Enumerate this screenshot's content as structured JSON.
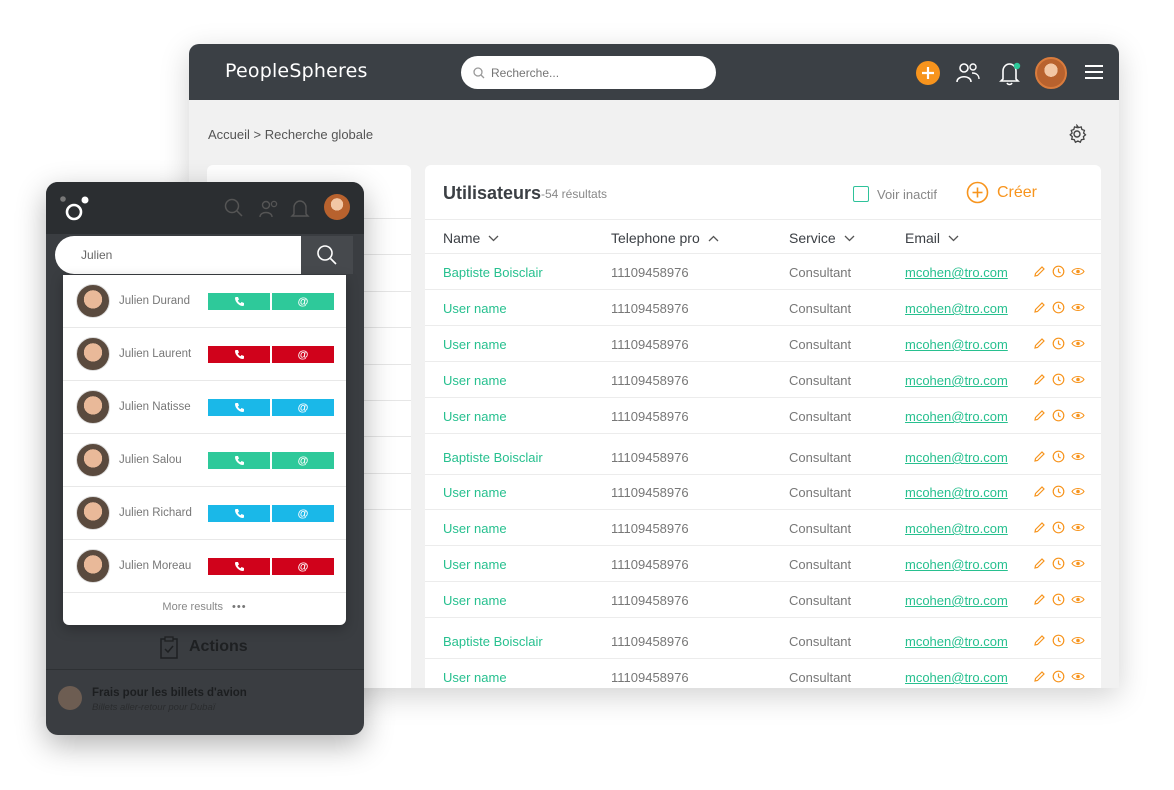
{
  "app": {
    "logo": "PeopleSpheres"
  },
  "header": {
    "search_placeholder": "Recherche..."
  },
  "breadcrumb": "Accueil > Recherche globale",
  "users_card": {
    "title": "Utilisateurs",
    "count": "-54 résultats",
    "voir_inactif": "Voir inactif",
    "create_label": "Créer",
    "columns": [
      "Name",
      "Telephone pro",
      "Service",
      "Email"
    ],
    "rows": [
      {
        "name": "Baptiste Boisclair",
        "tel": "11109458976",
        "service": "Consultant",
        "email": "mcohen@tro.com"
      },
      {
        "name": "User name",
        "tel": "11109458976",
        "service": "Consultant",
        "email": "mcohen@tro.com"
      },
      {
        "name": "User name",
        "tel": "11109458976",
        "service": "Consultant",
        "email": "mcohen@tro.com"
      },
      {
        "name": "User name",
        "tel": "11109458976",
        "service": "Consultant",
        "email": "mcohen@tro.com"
      },
      {
        "name": "User name",
        "tel": "11109458976",
        "service": "Consultant",
        "email": "mcohen@tro.com"
      },
      {
        "name": "Baptiste Boisclair",
        "tel": "11109458976",
        "service": "Consultant",
        "email": "mcohen@tro.com"
      },
      {
        "name": "User name",
        "tel": "11109458976",
        "service": "Consultant",
        "email": "mcohen@tro.com"
      },
      {
        "name": "User name",
        "tel": "11109458976",
        "service": "Consultant",
        "email": "mcohen@tro.com"
      },
      {
        "name": "User name",
        "tel": "11109458976",
        "service": "Consultant",
        "email": "mcohen@tro.com"
      },
      {
        "name": "User name",
        "tel": "11109458976",
        "service": "Consultant",
        "email": "mcohen@tro.com"
      },
      {
        "name": "Baptiste Boisclair",
        "tel": "11109458976",
        "service": "Consultant",
        "email": "mcohen@tro.com"
      },
      {
        "name": "User name",
        "tel": "11109458976",
        "service": "Consultant",
        "email": "mcohen@tro.com"
      }
    ]
  },
  "mobile": {
    "search_value": "Julien",
    "results": [
      {
        "name": "Julien Durand",
        "color": "#2ec99a"
      },
      {
        "name": "Julien Laurent",
        "color": "#d0021b"
      },
      {
        "name": "Julien Natisse",
        "color": "#1ab8e8"
      },
      {
        "name": "Julien Salou",
        "color": "#2ec99a"
      },
      {
        "name": "Julien Richard",
        "color": "#1ab8e8"
      },
      {
        "name": "Julien Moreau",
        "color": "#d0021b"
      }
    ],
    "at_symbol": "@",
    "more_results": "More results",
    "more_dots": "•••",
    "actions_label": "Actions",
    "action_item": {
      "title": "Frais pour les billets d'avion",
      "subtitle": "Billets aller-retour pour Dubaï"
    }
  },
  "colors": {
    "accent_green": "#27c08f",
    "accent_orange": "#f7941d",
    "header_dark": "#3b4045"
  }
}
